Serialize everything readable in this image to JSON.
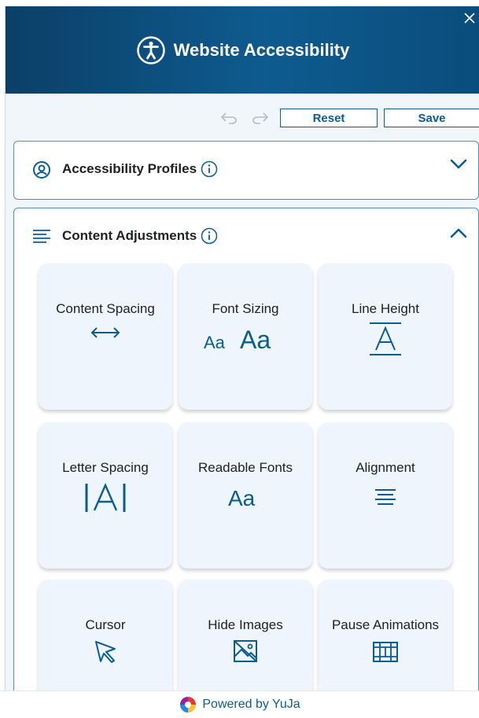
{
  "header": {
    "title": "Website Accessibility",
    "icon": "accessibility-icon"
  },
  "toolbar": {
    "reset_label": "Reset",
    "save_label": "Save"
  },
  "profiles": {
    "title": "Accessibility Profiles",
    "expanded": false
  },
  "content": {
    "title": "Content Adjustments",
    "expanded": true,
    "cards": [
      {
        "label": "Content Spacing",
        "icon": "double-arrow-icon"
      },
      {
        "label": "Font Sizing",
        "icon": "font-size-icon"
      },
      {
        "label": "Line Height",
        "icon": "line-height-icon"
      },
      {
        "label": "Letter Spacing",
        "icon": "letter-spacing-icon"
      },
      {
        "label": "Readable Fonts",
        "icon": "readable-font-icon"
      },
      {
        "label": "Alignment",
        "icon": "alignment-icon"
      },
      {
        "label": "Cursor",
        "icon": "cursor-icon"
      },
      {
        "label": "Hide Images",
        "icon": "hide-images-icon"
      },
      {
        "label": "Pause Animations",
        "icon": "film-icon"
      }
    ]
  },
  "footer": {
    "text": "Powered by YuJa"
  },
  "colors": {
    "accent": "#0b5c91",
    "header_dark": "#0b3f67",
    "border": "#4d8fc2"
  }
}
